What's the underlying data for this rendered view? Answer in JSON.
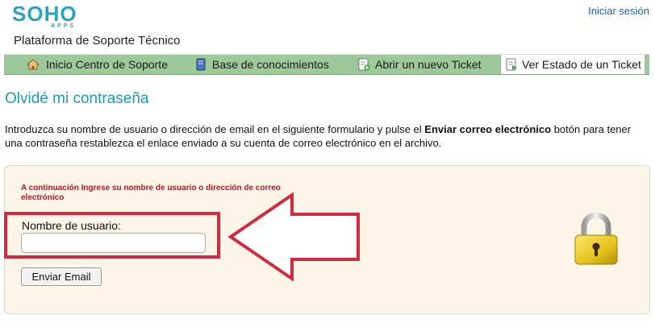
{
  "header": {
    "logo_text_main": "SOHO",
    "logo_text_sub": "APPS",
    "platform_title": "Plataforma de Soporte Técnico",
    "login_link": "Iniciar sesión"
  },
  "nav": {
    "items": [
      {
        "label": "Inicio Centro de Soporte",
        "icon": "home-icon"
      },
      {
        "label": "Base de conocimientos",
        "icon": "book-icon"
      },
      {
        "label": "Abrir un nuevo Ticket",
        "icon": "new-ticket-icon"
      },
      {
        "label": "Ver Estado de un Ticket",
        "icon": "ticket-status-icon",
        "active": true
      }
    ]
  },
  "page": {
    "heading": "Olvidé mi contraseña",
    "intro_before": "Introduzca su nombre de usuario o dirección de email en el siguiente formulario y pulse el ",
    "intro_bold": "Enviar correo electrónico",
    "intro_after": " botón para tener una contraseña restablezca el enlace enviado a su cuenta de correo electrónico en el archivo."
  },
  "form": {
    "note": "A continuación Ingrese su nombre de usuario o dirección de correo electrónico",
    "username_label": "Nombre de usuario:",
    "username_value": "",
    "submit_label": "Enviar Email"
  },
  "colors": {
    "brand": "#2aa3c0",
    "nav_bg": "#9dc99a",
    "heading": "#1d9ab8",
    "note_red": "#c1121f",
    "annotation_red": "#d22a3e",
    "panel_bg": "#fdf5e8"
  }
}
